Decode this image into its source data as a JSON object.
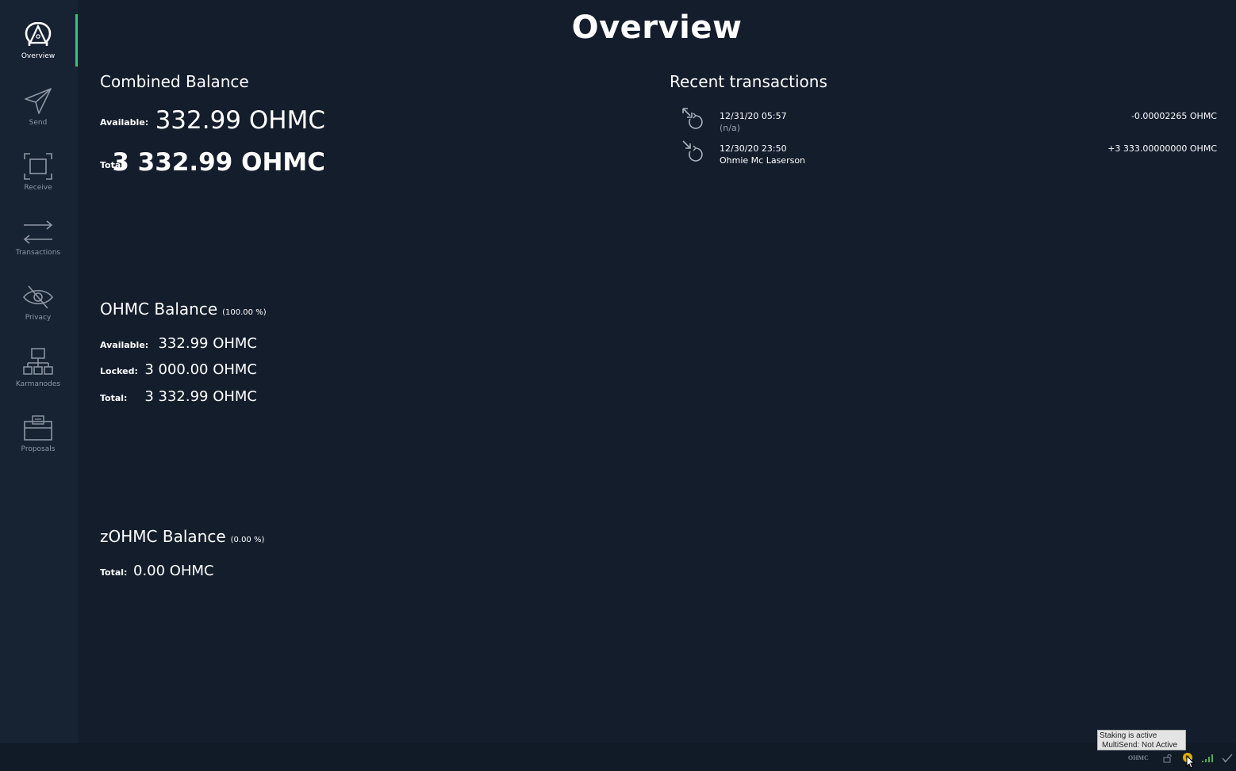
{
  "page": {
    "title": "Overview"
  },
  "sidebar": {
    "items": [
      {
        "label": "Overview",
        "icon": "logo-icon"
      },
      {
        "label": "Send",
        "icon": "send-icon"
      },
      {
        "label": "Receive",
        "icon": "receive-icon"
      },
      {
        "label": "Transactions",
        "icon": "transactions-icon"
      },
      {
        "label": "Privacy",
        "icon": "privacy-icon"
      },
      {
        "label": "Karmanodes",
        "icon": "karmanodes-icon"
      },
      {
        "label": "Proposals",
        "icon": "proposals-icon"
      }
    ],
    "active_index": 0,
    "accent_color": "#2ecc71"
  },
  "combined_balance": {
    "title": "Combined Balance",
    "available_label": "Available:",
    "available_value": "332.99 OHMC",
    "total_label": "Total:",
    "total_value": "3 332.99 OHMC"
  },
  "ohmc_balance": {
    "title": "OHMC Balance",
    "percent": "(100.00 %)",
    "available_label": "Available:",
    "available_value": "332.99 OHMC",
    "locked_label": "Locked:",
    "locked_value": "3 000.00 OHMC",
    "total_label": "Total:",
    "total_value": "3 332.99 OHMC"
  },
  "zohmc_balance": {
    "title": "zOHMC Balance",
    "percent": "(0.00 %)",
    "total_label": "Total:",
    "total_value": "0.00 OHMC"
  },
  "recent_transactions": {
    "title": "Recent transactions",
    "items": [
      {
        "date": "12/31/20 05:57",
        "description": "(n/a)",
        "amount": "-0.00002265 OHMC",
        "icon": "stake-icon"
      },
      {
        "date": "12/30/20 23:50",
        "description": "Ohmie Mc Laserson",
        "amount": "+3 333.00000000 OHMC",
        "icon": "received-icon"
      }
    ]
  },
  "statusbar": {
    "unit": "OHMC",
    "tooltip_line1": "Staking is active",
    "tooltip_line2": "MultiSend: Not Active",
    "staking_color": "#e0b000",
    "connection_color": "#4caf50"
  }
}
